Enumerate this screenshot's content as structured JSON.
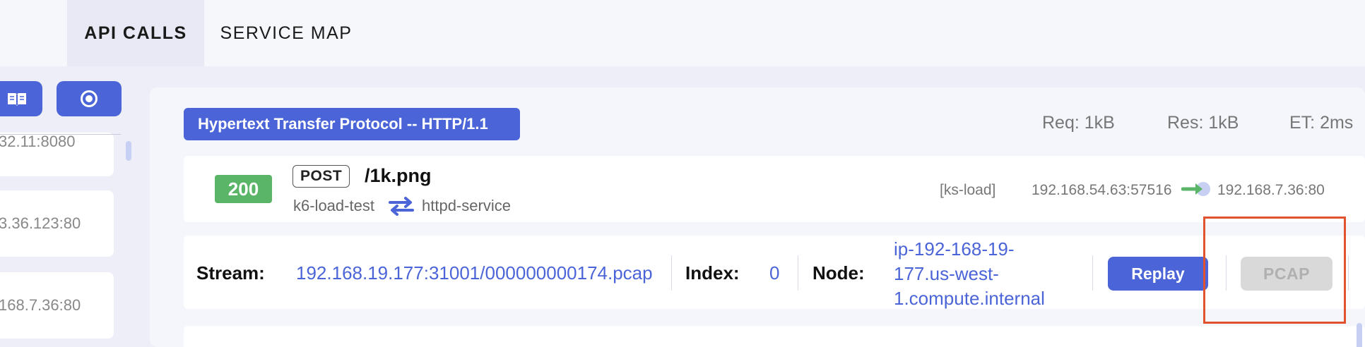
{
  "tabs": [
    {
      "label": "API CALLS",
      "active": true
    },
    {
      "label": "SERVICE MAP",
      "active": false
    }
  ],
  "left": {
    "buttons": [
      {
        "icon": "book-icon"
      },
      {
        "icon": "record-icon"
      }
    ],
    "entries": [
      {
        "text": "32.11:8080"
      },
      {
        "text": "3.36.123:80"
      },
      {
        "text": "168.7.36:80"
      }
    ]
  },
  "detail": {
    "protocol": "Hypertext Transfer Protocol -- HTTP/1.1",
    "req_size": "Req: 1kB",
    "res_size": "Res: 1kB",
    "elapsed": "ET: 2ms",
    "status_code": "200",
    "status_color": "#5bb568",
    "method": "POST",
    "path": "/1k.png",
    "source_service": "k6-load-test",
    "dest_service": "httpd-service",
    "namespace": "[ks-load]",
    "source_ip": "192.168.54.63:57516",
    "dest_ip": "192.168.7.36:80",
    "stream_label": "Stream:",
    "stream_value": "192.168.19.177:31001/000000000174.pcap",
    "index_label": "Index:",
    "index_value": "0",
    "node_label": "Node:",
    "node_value": "ip-192-168-19-177.us-west-1.compute.internal",
    "replay_label": "Replay",
    "pcap_label": "PCAP"
  },
  "colors": {
    "accent": "#4b64d8",
    "highlight": "#e0532e"
  }
}
